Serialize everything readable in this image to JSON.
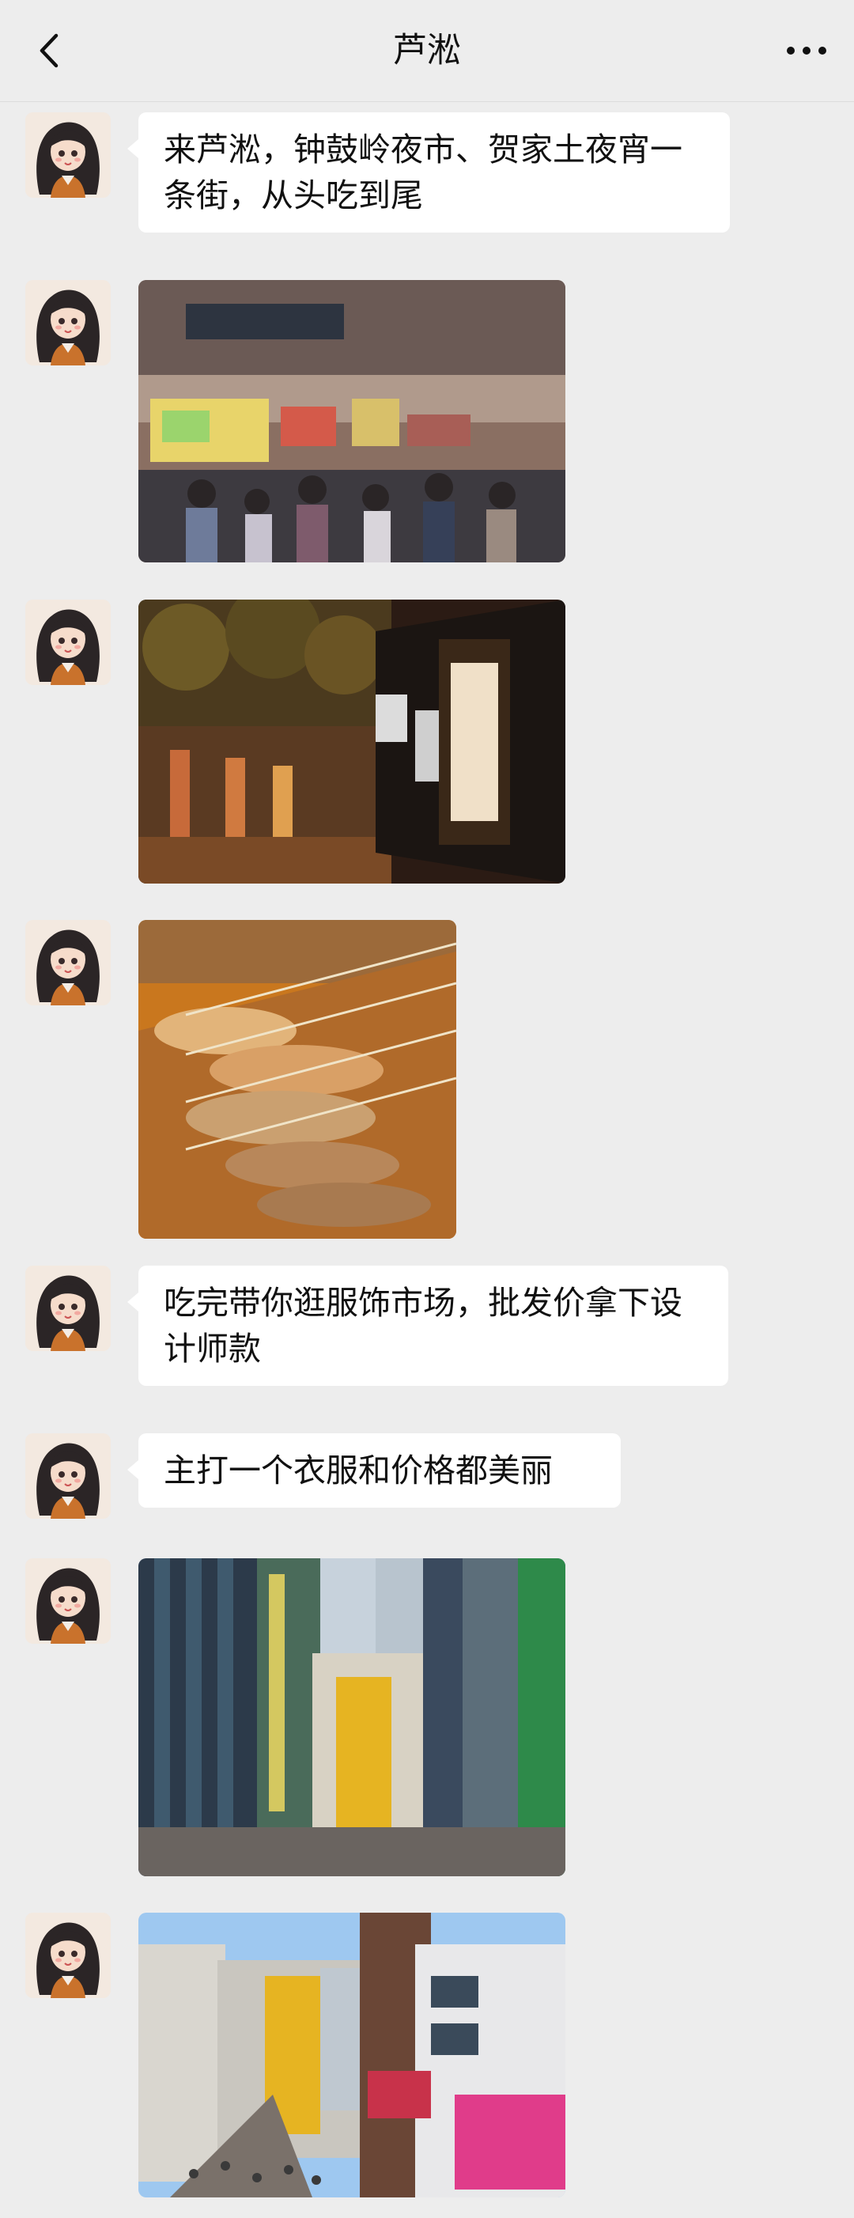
{
  "header": {
    "title": "芦淞",
    "back_icon": "chevron-left-icon",
    "more_icon": "more-horizontal-icon"
  },
  "messages": [
    {
      "type": "text",
      "text": "来芦淞，钟鼓岭夜市、贺家土夜宵一条街，从头吃到尾"
    },
    {
      "type": "image",
      "image": "night-market-crowd-photo"
    },
    {
      "type": "image",
      "image": "night-street-sign-photo"
    },
    {
      "type": "image",
      "image": "skewers-bbq-photo"
    },
    {
      "type": "text",
      "text": "吃完带你逛服饰市场，批发价拿下设计师款"
    },
    {
      "type": "text",
      "text": "主打一个衣服和价格都美丽"
    },
    {
      "type": "image",
      "image": "shopping-district-building-photo"
    },
    {
      "type": "image",
      "image": "shopping-district-street-photo"
    }
  ]
}
